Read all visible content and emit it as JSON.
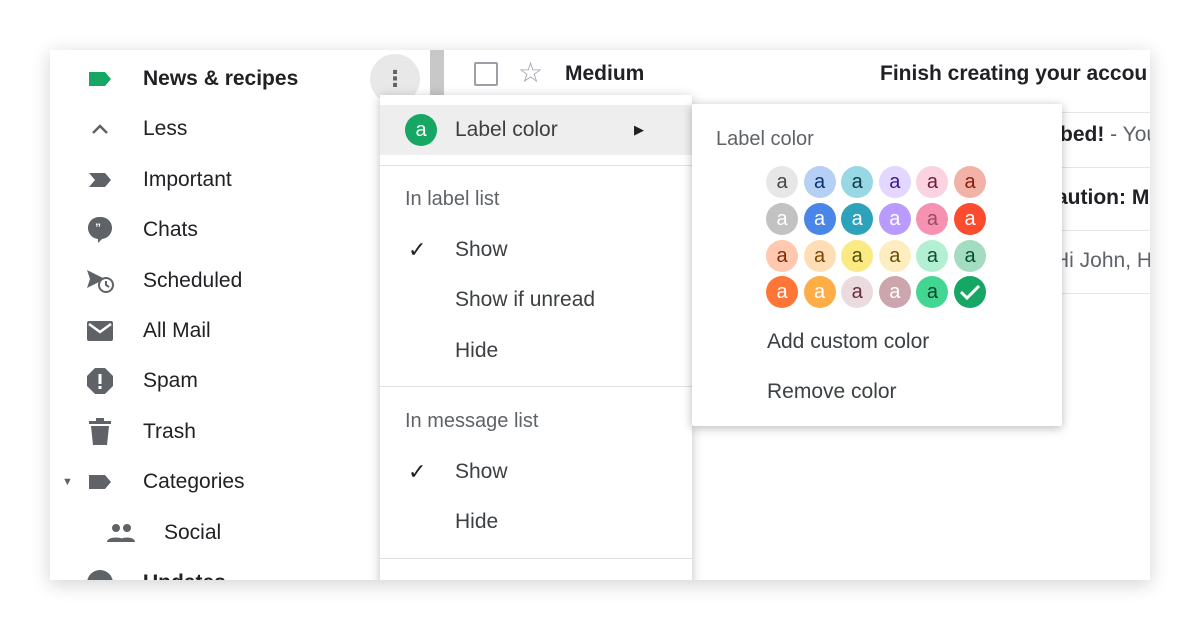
{
  "sidebar": {
    "items": [
      {
        "label": "News & recipes",
        "icon": "label-icon",
        "bold": true
      },
      {
        "label": "Less",
        "icon": "chevron-up-icon"
      },
      {
        "label": "Important",
        "icon": "important-icon"
      },
      {
        "label": "Chats",
        "icon": "chat-icon"
      },
      {
        "label": "Scheduled",
        "icon": "scheduled-icon"
      },
      {
        "label": "All Mail",
        "icon": "mail-icon"
      },
      {
        "label": "Spam",
        "icon": "spam-icon"
      },
      {
        "label": "Trash",
        "icon": "trash-icon"
      },
      {
        "label": "Categories",
        "icon": "label-icon"
      },
      {
        "label": "Social",
        "icon": "people-icon"
      },
      {
        "label": "Updates",
        "icon": "info-icon",
        "bold": true
      }
    ],
    "label_color": "#16a765",
    "more_icon": "more-vert-icon"
  },
  "emails": [
    {
      "sender": "Medium",
      "subject": "Finish creating your accou"
    },
    {
      "subject": "bed!",
      "snippet": " - You"
    },
    {
      "subject": "aution: M",
      "snippet": ""
    },
    {
      "subject": "",
      "snippet": "Hi John, H"
    }
  ],
  "menu": {
    "label_color": "Label color",
    "avatar_letter": "a",
    "in_label_list": "In label list",
    "label_list_options": [
      "Show",
      "Show if unread",
      "Hide"
    ],
    "label_list_selected": "Show",
    "in_message_list": "In message list",
    "message_list_options": [
      "Show",
      "Hide"
    ],
    "message_list_selected": "Show"
  },
  "submenu": {
    "title": "Label color",
    "letter": "a",
    "swatches": [
      [
        [
          "#e7e7e7",
          "#464646"
        ],
        [
          "#b6cff5",
          "#0d3472"
        ],
        [
          "#98d7e4",
          "#0d3b44"
        ],
        [
          "#e3d7ff",
          "#3d188e"
        ],
        [
          "#fbd3e0",
          "#711a36"
        ],
        [
          "#f2b2a8",
          "#8a1c0a"
        ]
      ],
      [
        [
          "#c2c2c2",
          "#ffffff"
        ],
        [
          "#4986e7",
          "#ffffff"
        ],
        [
          "#2da2bb",
          "#ffffff"
        ],
        [
          "#b99aff",
          "#ffffff"
        ],
        [
          "#f691b2",
          "#994a64"
        ],
        [
          "#fb4c2f",
          "#ffffff"
        ]
      ],
      [
        [
          "#ffc8af",
          "#7a2e0b"
        ],
        [
          "#ffdeb5",
          "#7a4706"
        ],
        [
          "#fbe983",
          "#594c05"
        ],
        [
          "#fdedc1",
          "#684e07"
        ],
        [
          "#b3efd3",
          "#0b4f30"
        ],
        [
          "#a2dcc1",
          "#04502e"
        ]
      ],
      [
        [
          "#ff7537",
          "#ffffff"
        ],
        [
          "#ffad46",
          "#ffffff"
        ],
        [
          "#ebdbde",
          "#662e37"
        ],
        [
          "#cca6ac",
          "#ffffff"
        ],
        [
          "#42d692",
          "#094228"
        ],
        [
          "#16a765",
          "#ffffff"
        ]
      ]
    ],
    "selected": "#16a765",
    "add_custom": "Add custom color",
    "remove": "Remove color"
  }
}
